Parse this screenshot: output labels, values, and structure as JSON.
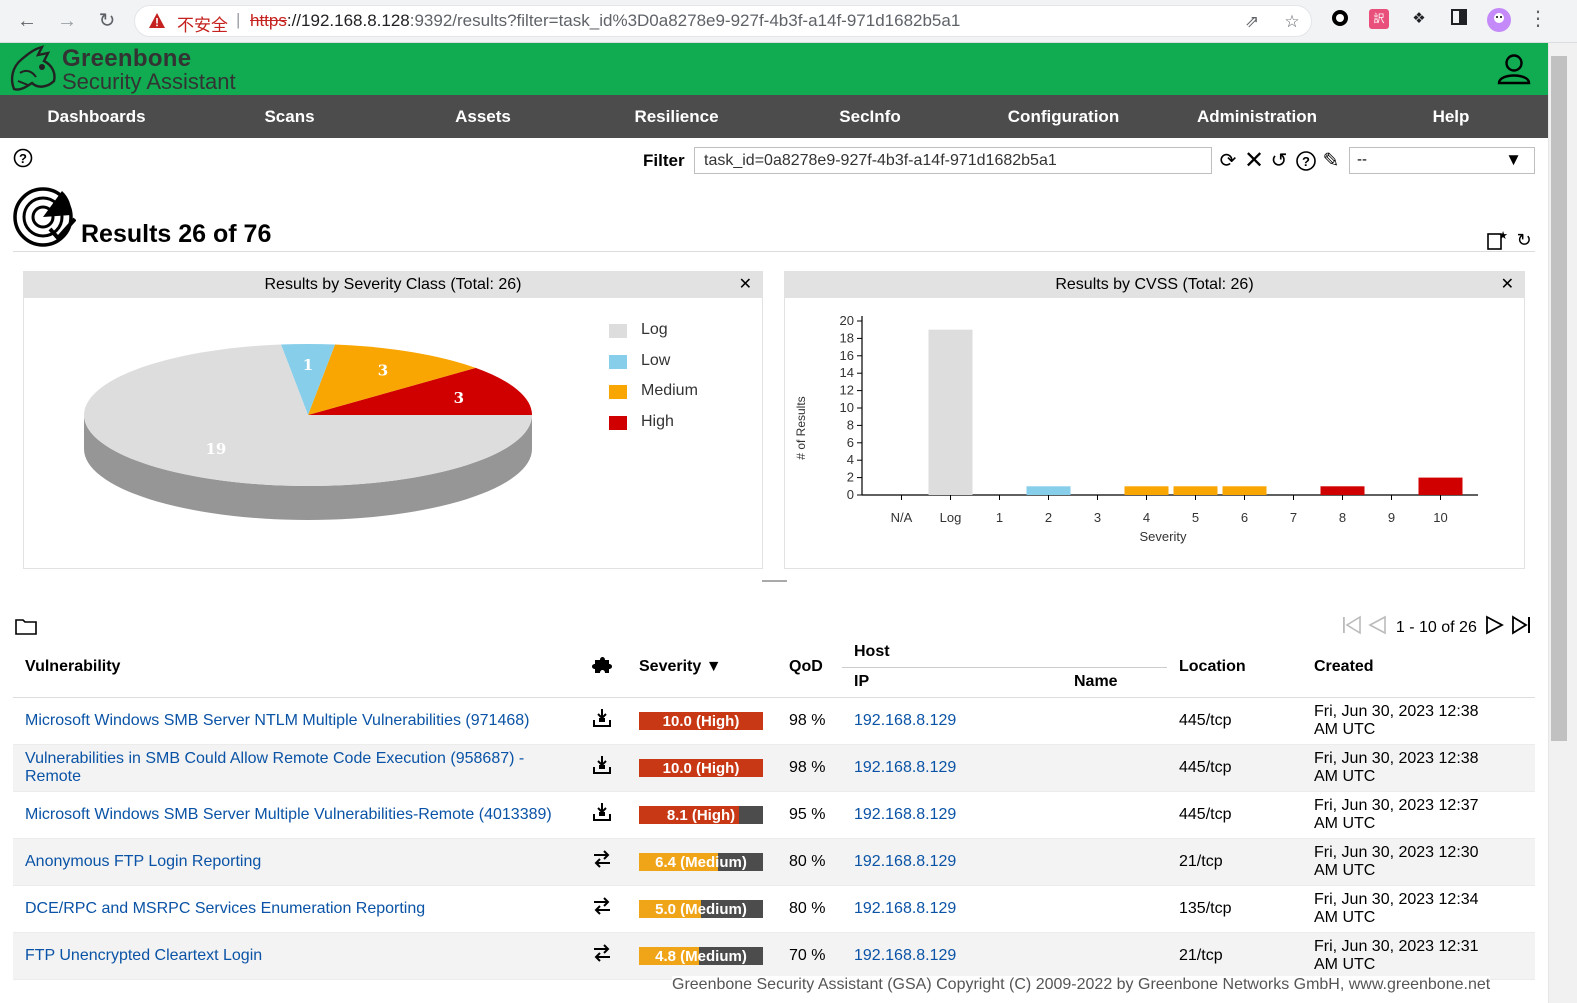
{
  "browser": {
    "security_label": "不安全",
    "url_scheme": "https",
    "url_host": "://192.168.8.128",
    "url_rest": ":9392/results?filter=task_id%3D0a8278e9-927f-4b3f-a14f-971d1682b5a1"
  },
  "app": {
    "brand_line1": "Greenbone",
    "brand_line2": "Security Assistant"
  },
  "menu": [
    "Dashboards",
    "Scans",
    "Assets",
    "Resilience",
    "SecInfo",
    "Configuration",
    "Administration",
    "Help"
  ],
  "toolbar": {
    "filter_label": "Filter",
    "filter_value": "task_id=0a8278e9-927f-4b3f-a14f-971d1682b5a1",
    "filter_select": "--"
  },
  "page": {
    "title": "Results 26 of 76"
  },
  "pie_panel": {
    "title": "Results by Severity Class (Total: 26)"
  },
  "bar_panel": {
    "title": "Results by CVSS (Total: 26)"
  },
  "chart_data": [
    {
      "type": "pie",
      "title": "Results by Severity Class (Total: 26)",
      "categories": [
        "Log",
        "Low",
        "Medium",
        "High"
      ],
      "values": [
        19,
        1,
        3,
        3
      ],
      "colors": [
        "#dddddd",
        "#87ceeb",
        "#f9a602",
        "#d00000"
      ],
      "legend_position": "right"
    },
    {
      "type": "bar",
      "title": "Results by CVSS (Total: 26)",
      "xlabel": "Severity",
      "ylabel": "# of Results",
      "categories": [
        "N/A",
        "Log",
        "1",
        "2",
        "3",
        "4",
        "5",
        "6",
        "7",
        "8",
        "9",
        "10"
      ],
      "values": [
        0,
        19,
        0,
        1,
        0,
        1,
        1,
        1,
        0,
        1,
        0,
        2
      ],
      "colors": [
        "#dddddd",
        "#dddddd",
        "#87ceeb",
        "#87ceeb",
        "#87ceeb",
        "#f9a602",
        "#f9a602",
        "#f9a602",
        "#d00000",
        "#d00000",
        "#d00000",
        "#d00000"
      ],
      "ylim": [
        0,
        20
      ],
      "yticks": [
        0,
        2,
        4,
        6,
        8,
        10,
        12,
        14,
        16,
        18,
        20
      ]
    }
  ],
  "pager": {
    "text": "1 - 10 of 26"
  },
  "table": {
    "headers": {
      "vulnerability": "Vulnerability",
      "severity": "Severity ▼",
      "qod": "QoD",
      "host": "Host",
      "ip": "IP",
      "name": "Name",
      "location": "Location",
      "created": "Created"
    },
    "rows": [
      {
        "vuln": "Microsoft Windows SMB Server NTLM Multiple Vulnerabilities (971468)",
        "type": "local",
        "sev_label": "10.0 (High)",
        "sev": 10.0,
        "sev_color": "#c83814",
        "qod": "98 %",
        "ip": "192.168.8.129",
        "name": "",
        "location": "445/tcp",
        "created1": "Fri, Jun 30, 2023 12:38",
        "created2": "AM UTC"
      },
      {
        "vuln": "Vulnerabilities in SMB Could Allow Remote Code Execution (958687) - Remote",
        "type": "local",
        "sev_label": "10.0 (High)",
        "sev": 10.0,
        "sev_color": "#c83814",
        "qod": "98 %",
        "ip": "192.168.8.129",
        "name": "",
        "location": "445/tcp",
        "created1": "Fri, Jun 30, 2023 12:38",
        "created2": "AM UTC"
      },
      {
        "vuln": "Microsoft Windows SMB Server Multiple Vulnerabilities-Remote (4013389)",
        "type": "local",
        "sev_label": "8.1 (High)",
        "sev": 8.1,
        "sev_color": "#c83814",
        "qod": "95 %",
        "ip": "192.168.8.129",
        "name": "",
        "location": "445/tcp",
        "created1": "Fri, Jun 30, 2023 12:37",
        "created2": "AM UTC"
      },
      {
        "vuln": "Anonymous FTP Login Reporting",
        "type": "remote",
        "sev_label": "6.4 (Medium)",
        "sev": 6.4,
        "sev_color": "#f0a519",
        "qod": "80 %",
        "ip": "192.168.8.129",
        "name": "",
        "location": "21/tcp",
        "created1": "Fri, Jun 30, 2023 12:30",
        "created2": "AM UTC"
      },
      {
        "vuln": "DCE/RPC and MSRPC Services Enumeration Reporting",
        "type": "remote",
        "sev_label": "5.0 (Medium)",
        "sev": 5.0,
        "sev_color": "#f0a519",
        "qod": "80 %",
        "ip": "192.168.8.129",
        "name": "",
        "location": "135/tcp",
        "created1": "Fri, Jun 30, 2023 12:34",
        "created2": "AM UTC"
      },
      {
        "vuln": "FTP Unencrypted Cleartext Login",
        "type": "remote",
        "sev_label": "4.8 (Medium)",
        "sev": 4.8,
        "sev_color": "#f0a519",
        "qod": "70 %",
        "ip": "192.168.8.129",
        "name": "",
        "location": "21/tcp",
        "created1": "Fri, Jun 30, 2023 12:31",
        "created2": "AM UTC"
      }
    ]
  },
  "footer": {
    "text": "Greenbone Security Assistant (GSA) Copyright (C) 2009-2022 by Greenbone Networks GmbH, www.greenbone.net"
  },
  "icons": [
    "back-icon",
    "forward-icon",
    "reload-icon",
    "warning-icon",
    "share-icon",
    "star-icon",
    "extensions-icon",
    "sidepanel-icon",
    "profile-icon",
    "menu-icon",
    "user-icon",
    "help-icon",
    "refresh-filter-icon",
    "clear-filter-icon",
    "reset-filter-icon",
    "filter-help-icon",
    "edit-filter-icon",
    "results-icon",
    "new-dashboard-icon",
    "reset-dashboard-icon",
    "folder-icon",
    "first-page-icon",
    "prev-page-icon",
    "next-page-icon",
    "last-page-icon",
    "local-detection-icon",
    "remote-detection-icon"
  ]
}
